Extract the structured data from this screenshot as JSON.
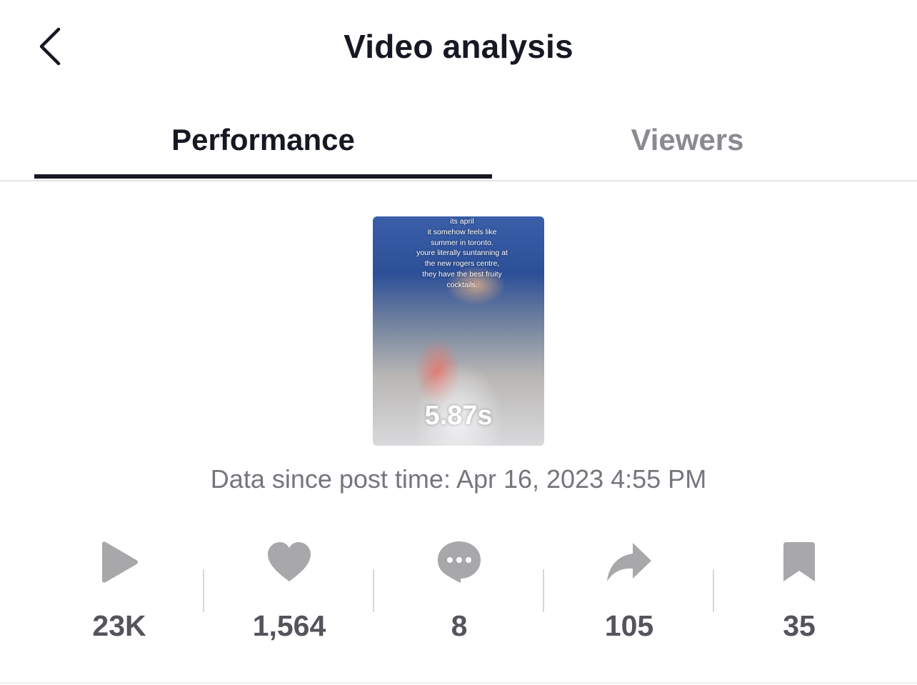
{
  "header": {
    "title": "Video analysis",
    "back_icon": "chevron-left-icon"
  },
  "tabs": [
    {
      "label": "Performance",
      "active": true
    },
    {
      "label": "Viewers",
      "active": false
    }
  ],
  "video": {
    "caption_lines": [
      "its april",
      "it somehow feels like",
      "summer in toronto.",
      "youre literally suntanning at",
      "the new rogers centre,",
      "they have the best fruity",
      "cocktails."
    ],
    "duration": "5.87s"
  },
  "post_time": "Data since post time: Apr 16, 2023 4:55 PM",
  "stats": [
    {
      "icon": "play-icon",
      "value": "23K"
    },
    {
      "icon": "heart-icon",
      "value": "1,564"
    },
    {
      "icon": "comment-icon",
      "value": "8"
    },
    {
      "icon": "share-icon",
      "value": "105"
    },
    {
      "icon": "bookmark-icon",
      "value": "35"
    }
  ],
  "colors": {
    "text_primary": "#161823",
    "text_secondary": "#75767c",
    "icon_gray": "#a8a8ab",
    "stat_value": "#54555b",
    "inactive_tab": "#8a8b91"
  }
}
